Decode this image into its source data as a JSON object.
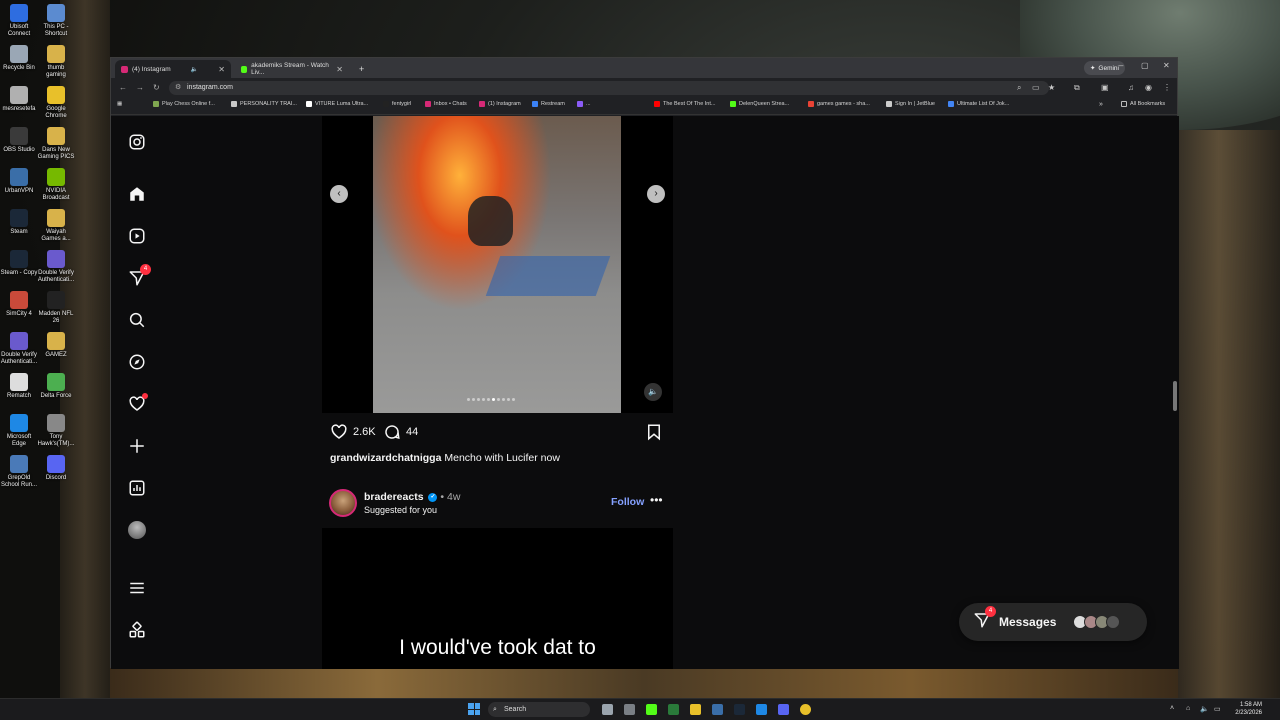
{
  "desktop": {
    "icons": [
      {
        "label": "Ubisoft Connect",
        "color": "#2e6de0"
      },
      {
        "label": "This PC - Shortcut",
        "color": "#5b8bd0"
      },
      {
        "label": "Recycle Bin",
        "color": "#9aa7b5"
      },
      {
        "label": "thumb gaming",
        "color": "#d8b24a"
      },
      {
        "label": "mesresetefa",
        "color": "#b0b0b0"
      },
      {
        "label": "Google Chrome",
        "color": "#e8c02a"
      },
      {
        "label": "OBS Studio",
        "color": "#3a3a3a"
      },
      {
        "label": "Dans New Gaming PICS",
        "color": "#d8b24a"
      },
      {
        "label": "UrbanVPN",
        "color": "#3a6ea8"
      },
      {
        "label": "NVIDIA Broadcast",
        "color": "#76b900"
      },
      {
        "label": "Steam",
        "color": "#1b2838"
      },
      {
        "label": "Waiyah Games a...",
        "color": "#d8b24a"
      },
      {
        "label": "Steam - Copy",
        "color": "#1b2838"
      },
      {
        "label": "Double Verify Authenticati...",
        "color": "#6a5acd"
      },
      {
        "label": "SimCity 4",
        "color": "#c94a3a"
      },
      {
        "label": "Madden NFL 26",
        "color": "#222222"
      },
      {
        "label": "Double Verify Authenticati...",
        "color": "#6a5acd"
      },
      {
        "label": "GAMEZ",
        "color": "#d8b24a"
      },
      {
        "label": "Rematch",
        "color": "#dddddd"
      },
      {
        "label": "Delta Force",
        "color": "#4caf50"
      },
      {
        "label": "Microsoft Edge",
        "color": "#1e88e5"
      },
      {
        "label": "Tony Hawk's(TM)...",
        "color": "#888888"
      },
      {
        "label": "GrepOld School Run...",
        "color": "#4a7ab8"
      },
      {
        "label": "Discord",
        "color": "#5865f2"
      }
    ]
  },
  "browser": {
    "tabs": [
      {
        "title": "(4) Instagram",
        "favicon_color": "#d62976",
        "active": true
      },
      {
        "title": "akademiks Stream - Watch Liv...",
        "favicon_color": "#53fc18",
        "active": false
      }
    ],
    "new_tab": "+",
    "gemini_label": "Gemini",
    "window_controls": {
      "minimize": "–",
      "maximize": "▢",
      "close": "✕"
    },
    "address": "instagram.com",
    "bookmarks": [
      {
        "label": "Play Chess Online f...",
        "color": "#7fa650"
      },
      {
        "label": "PERSONALITY TRAI...",
        "color": "#c8c8c8"
      },
      {
        "label": "VITURE Luma Ultra...",
        "color": "#ffffff"
      },
      {
        "label": "fentygirl",
        "color": "#222222"
      },
      {
        "label": "Inbox • Chats",
        "color": "#d62976"
      },
      {
        "label": "(1) Instagram",
        "color": "#d62976"
      },
      {
        "label": "Restream",
        "color": "#3b82f6"
      },
      {
        "label": "...",
        "color": "#8b5cf6"
      },
      {
        "label": "The Best Of The Int...",
        "color": "#ff0000"
      },
      {
        "label": "DelenQueen Strea...",
        "color": "#53fc18"
      },
      {
        "label": "games games - sha...",
        "color": "#ea4335"
      },
      {
        "label": "Sign In | JetBlue",
        "color": "#cccccc"
      },
      {
        "label": "Ultimate List Of Jok...",
        "color": "#4285f4"
      }
    ],
    "all_bookmarks": "All Bookmarks"
  },
  "instagram": {
    "sidebar": {
      "messages_badge": "4"
    },
    "post1": {
      "likes": "2.6K",
      "comments": "44",
      "username": "grandwizardchatnigga",
      "caption": "Mencho with Lucifer now"
    },
    "post2": {
      "username": "bradereacts",
      "time": "• 4w",
      "suggested": "Suggested for you",
      "follow": "Follow",
      "subtitle": "I would've took dat to"
    },
    "messages_pill": {
      "label": "Messages",
      "badge": "4"
    }
  },
  "taskbar": {
    "search": "Search",
    "time": "1:58 AM",
    "date": "2/23/2026"
  }
}
